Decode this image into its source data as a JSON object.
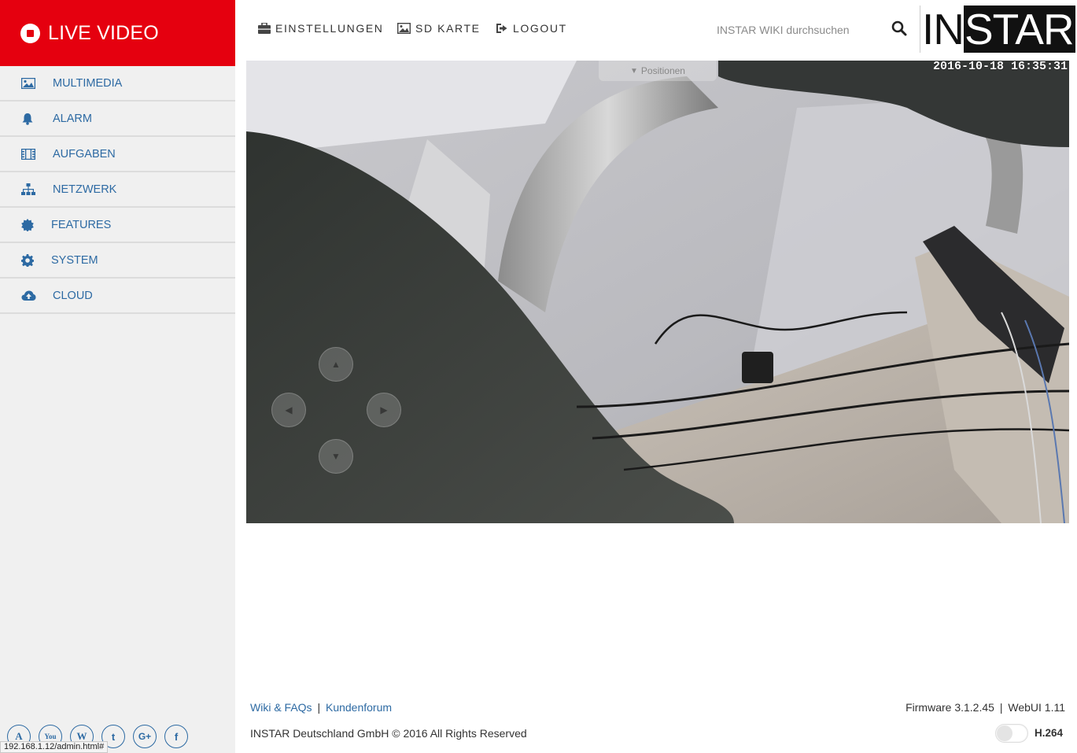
{
  "sidebar": {
    "brand_label": "LIVE VIDEO",
    "items": [
      {
        "label": "MULTIMEDIA",
        "icon": "image-icon"
      },
      {
        "label": "ALARM",
        "icon": "bell-icon"
      },
      {
        "label": "AUFGABEN",
        "icon": "film-icon"
      },
      {
        "label": "NETZWERK",
        "icon": "sitemap-icon"
      },
      {
        "label": "FEATURES",
        "icon": "certificate-icon"
      },
      {
        "label": "SYSTEM",
        "icon": "gear-icon"
      },
      {
        "label": "CLOUD",
        "icon": "cloud-upload-icon"
      }
    ],
    "social": [
      {
        "icon": "instar-icon",
        "glyph": "A"
      },
      {
        "icon": "youtube-icon",
        "glyph": "You"
      },
      {
        "icon": "wikipedia-icon",
        "glyph": "W"
      },
      {
        "icon": "twitter-icon",
        "glyph": "t"
      },
      {
        "icon": "google-plus-icon",
        "glyph": "G+"
      },
      {
        "icon": "facebook-icon",
        "glyph": "f"
      }
    ]
  },
  "topnav": {
    "settings_label": "EINSTELLUNGEN",
    "sdcard_label": "SD KARTE",
    "logout_label": "LOGOUT",
    "search_placeholder": "INSTAR WIKI durchsuchen",
    "logo_part1": "IN",
    "logo_part2": "STAR"
  },
  "video": {
    "timestamp": "2016-10-18 16:35:31",
    "positions_label": "Positionen"
  },
  "footer": {
    "wiki_link": "Wiki & FAQs",
    "separator": "|",
    "forum_link": "Kundenforum",
    "copyright": "INSTAR Deutschland GmbH © 2016 All Rights Reserved",
    "firmware": "Firmware 3.1.2.45",
    "webui": "WebUI 1.11",
    "codec_label": "H.264"
  },
  "browser_status": "192.168.1.12/admin.html#",
  "colors": {
    "brand_red": "#e5000f",
    "link_blue": "#2d6aa3"
  }
}
